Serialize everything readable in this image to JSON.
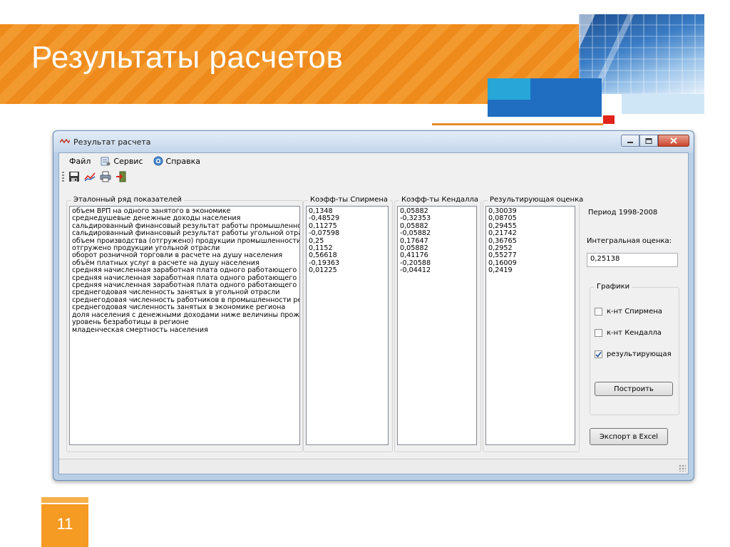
{
  "slide": {
    "title": "Результаты расчетов",
    "page_number": "11"
  },
  "window": {
    "title": "Результат расчета",
    "menu": [
      {
        "label": "Файл",
        "icon": ""
      },
      {
        "label": "Сервис",
        "icon": "tools-icon"
      },
      {
        "label": "Справка",
        "icon": "help-icon"
      }
    ],
    "toolbar_icons": [
      "save-icon",
      "chart-icon",
      "print-icon",
      "exit-icon"
    ]
  },
  "indicators": {
    "label": "Эталонный ряд показателей",
    "items": [
      "объем ВРП на одного занятого в экономике",
      "среднедушевые денежные доходы населения",
      "сальдированный финансовый результат работы промышленност",
      "сальдированный финансовый результат работы угольной отрасл",
      "объем производства (отгружено) продукции промышленности ре",
      "отгружено продукции угольной отрасли",
      "оборот розничной торговли в расчете на душу населения",
      "объём платных услуг в расчете на душу населения",
      "средняя начисленная заработная плата одного работающего в уг",
      "средняя начисленная заработная плата одного работающего в п",
      "средняя  начисленная заработная плата одного работающего в з",
      "среднегодовая численность занятых в угольной отрасли",
      "среднегодовая численность работников в промышленности реги",
      "среднегодовая  численность занятых в экономике региона",
      "доля населения с денежными доходами ниже величины прожито",
      "уровень безработицы в регионе",
      "младенческая смертность населения"
    ]
  },
  "spearman": {
    "label": "Коэфф-ты Спирмена",
    "values": [
      "0,1348",
      "-0,48529",
      "0,11275",
      "-0,07598",
      "0,25",
      "0,1152",
      "0,56618",
      "-0,19363",
      "0,01225"
    ]
  },
  "kendall": {
    "label": "Коэфф-ты Кендалла",
    "values": [
      "0,05882",
      "-0,32353",
      "0,05882",
      "-0,05882",
      "0,17647",
      "0,05882",
      "0,41176",
      "-0,20588",
      "-0,04412"
    ]
  },
  "result": {
    "label": "Результирующая оценка",
    "values": [
      "0,30039",
      "0,08705",
      "0,29455",
      "0,21742",
      "0,36765",
      "0,2952",
      "0,55277",
      "0,16009",
      "0,2419"
    ]
  },
  "side": {
    "period": "Период 1998-2008",
    "integral_label": "Интегральная оценка:",
    "integral_value": "0,25138",
    "charts_group": "Графики",
    "checkboxes": [
      {
        "label": "к-нт Спирмена",
        "checked": false
      },
      {
        "label": "к-нт Кендалла",
        "checked": false
      },
      {
        "label": "результирующая",
        "checked": true
      }
    ],
    "build_button": "Построить",
    "export_button": "Экспорт в Excel"
  }
}
